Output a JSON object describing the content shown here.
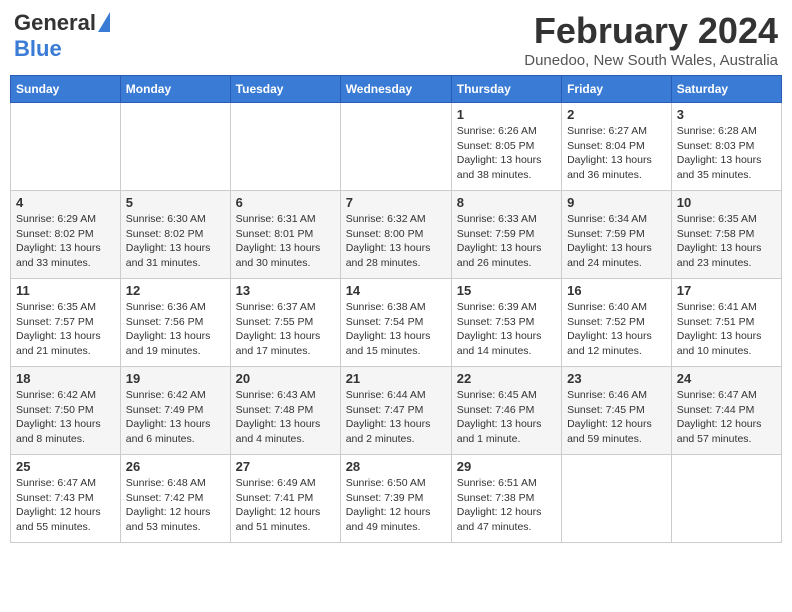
{
  "header": {
    "logo_general": "General",
    "logo_blue": "Blue",
    "month_year": "February 2024",
    "location": "Dunedoo, New South Wales, Australia"
  },
  "days_of_week": [
    "Sunday",
    "Monday",
    "Tuesday",
    "Wednesday",
    "Thursday",
    "Friday",
    "Saturday"
  ],
  "weeks": [
    [
      null,
      null,
      null,
      null,
      {
        "num": "1",
        "sunrise": "6:26 AM",
        "sunset": "8:05 PM",
        "daylight": "13 hours and 38 minutes."
      },
      {
        "num": "2",
        "sunrise": "6:27 AM",
        "sunset": "8:04 PM",
        "daylight": "13 hours and 36 minutes."
      },
      {
        "num": "3",
        "sunrise": "6:28 AM",
        "sunset": "8:03 PM",
        "daylight": "13 hours and 35 minutes."
      }
    ],
    [
      {
        "num": "4",
        "sunrise": "6:29 AM",
        "sunset": "8:02 PM",
        "daylight": "13 hours and 33 minutes."
      },
      {
        "num": "5",
        "sunrise": "6:30 AM",
        "sunset": "8:02 PM",
        "daylight": "13 hours and 31 minutes."
      },
      {
        "num": "6",
        "sunrise": "6:31 AM",
        "sunset": "8:01 PM",
        "daylight": "13 hours and 30 minutes."
      },
      {
        "num": "7",
        "sunrise": "6:32 AM",
        "sunset": "8:00 PM",
        "daylight": "13 hours and 28 minutes."
      },
      {
        "num": "8",
        "sunrise": "6:33 AM",
        "sunset": "7:59 PM",
        "daylight": "13 hours and 26 minutes."
      },
      {
        "num": "9",
        "sunrise": "6:34 AM",
        "sunset": "7:59 PM",
        "daylight": "13 hours and 24 minutes."
      },
      {
        "num": "10",
        "sunrise": "6:35 AM",
        "sunset": "7:58 PM",
        "daylight": "13 hours and 23 minutes."
      }
    ],
    [
      {
        "num": "11",
        "sunrise": "6:35 AM",
        "sunset": "7:57 PM",
        "daylight": "13 hours and 21 minutes."
      },
      {
        "num": "12",
        "sunrise": "6:36 AM",
        "sunset": "7:56 PM",
        "daylight": "13 hours and 19 minutes."
      },
      {
        "num": "13",
        "sunrise": "6:37 AM",
        "sunset": "7:55 PM",
        "daylight": "13 hours and 17 minutes."
      },
      {
        "num": "14",
        "sunrise": "6:38 AM",
        "sunset": "7:54 PM",
        "daylight": "13 hours and 15 minutes."
      },
      {
        "num": "15",
        "sunrise": "6:39 AM",
        "sunset": "7:53 PM",
        "daylight": "13 hours and 14 minutes."
      },
      {
        "num": "16",
        "sunrise": "6:40 AM",
        "sunset": "7:52 PM",
        "daylight": "13 hours and 12 minutes."
      },
      {
        "num": "17",
        "sunrise": "6:41 AM",
        "sunset": "7:51 PM",
        "daylight": "13 hours and 10 minutes."
      }
    ],
    [
      {
        "num": "18",
        "sunrise": "6:42 AM",
        "sunset": "7:50 PM",
        "daylight": "13 hours and 8 minutes."
      },
      {
        "num": "19",
        "sunrise": "6:42 AM",
        "sunset": "7:49 PM",
        "daylight": "13 hours and 6 minutes."
      },
      {
        "num": "20",
        "sunrise": "6:43 AM",
        "sunset": "7:48 PM",
        "daylight": "13 hours and 4 minutes."
      },
      {
        "num": "21",
        "sunrise": "6:44 AM",
        "sunset": "7:47 PM",
        "daylight": "13 hours and 2 minutes."
      },
      {
        "num": "22",
        "sunrise": "6:45 AM",
        "sunset": "7:46 PM",
        "daylight": "13 hours and 1 minute."
      },
      {
        "num": "23",
        "sunrise": "6:46 AM",
        "sunset": "7:45 PM",
        "daylight": "12 hours and 59 minutes."
      },
      {
        "num": "24",
        "sunrise": "6:47 AM",
        "sunset": "7:44 PM",
        "daylight": "12 hours and 57 minutes."
      }
    ],
    [
      {
        "num": "25",
        "sunrise": "6:47 AM",
        "sunset": "7:43 PM",
        "daylight": "12 hours and 55 minutes."
      },
      {
        "num": "26",
        "sunrise": "6:48 AM",
        "sunset": "7:42 PM",
        "daylight": "12 hours and 53 minutes."
      },
      {
        "num": "27",
        "sunrise": "6:49 AM",
        "sunset": "7:41 PM",
        "daylight": "12 hours and 51 minutes."
      },
      {
        "num": "28",
        "sunrise": "6:50 AM",
        "sunset": "7:39 PM",
        "daylight": "12 hours and 49 minutes."
      },
      {
        "num": "29",
        "sunrise": "6:51 AM",
        "sunset": "7:38 PM",
        "daylight": "12 hours and 47 minutes."
      },
      null,
      null
    ]
  ]
}
